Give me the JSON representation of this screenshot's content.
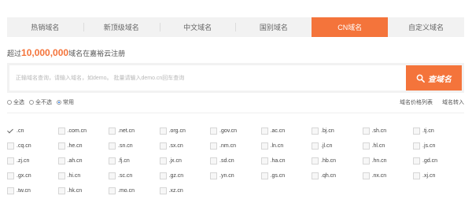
{
  "tabs": [
    {
      "label": "热销域名",
      "active": false
    },
    {
      "label": "新顶级域名",
      "active": false
    },
    {
      "label": "中文域名",
      "active": false
    },
    {
      "label": "国别域名",
      "active": false
    },
    {
      "label": "CN域名",
      "active": true
    },
    {
      "label": "自定义域名",
      "active": false
    }
  ],
  "headline": {
    "prefix": "超过",
    "count": "10,000,000",
    "suffix": "域名在嘉裕云注册"
  },
  "search": {
    "placeholder": "正输域名查询，请输入域名，如demo。 批量请输入demo.cn回车查询",
    "button_label": "查域名",
    "icon": "search-icon"
  },
  "filters": [
    {
      "label": "全选",
      "checked": false
    },
    {
      "label": "全不选",
      "checked": false
    },
    {
      "label": "常用",
      "checked": true
    }
  ],
  "links": {
    "price_list": "域名价格列表",
    "transfer": "域名转入"
  },
  "accent_color": "#f4743b",
  "domains": [
    {
      "label": ".cn",
      "checked": true
    },
    {
      "label": ".com.cn",
      "checked": false
    },
    {
      "label": ".net.cn",
      "checked": false
    },
    {
      "label": ".org.cn",
      "checked": false
    },
    {
      "label": ".gov.cn",
      "checked": false
    },
    {
      "label": ".ac.cn",
      "checked": false
    },
    {
      "label": ".bj.cn",
      "checked": false
    },
    {
      "label": ".sh.cn",
      "checked": false
    },
    {
      "label": ".tj.cn",
      "checked": false
    },
    {
      "label": ".cq.cn",
      "checked": false
    },
    {
      "label": ".he.cn",
      "checked": false
    },
    {
      "label": ".sn.cn",
      "checked": false
    },
    {
      "label": ".sx.cn",
      "checked": false
    },
    {
      "label": ".nm.cn",
      "checked": false
    },
    {
      "label": ".ln.cn",
      "checked": false
    },
    {
      "label": ".jl.cn",
      "checked": false
    },
    {
      "label": ".hl.cn",
      "checked": false
    },
    {
      "label": ".js.cn",
      "checked": false
    },
    {
      "label": ".zj.cn",
      "checked": false
    },
    {
      "label": ".ah.cn",
      "checked": false
    },
    {
      "label": ".fj.cn",
      "checked": false
    },
    {
      "label": ".jx.cn",
      "checked": false
    },
    {
      "label": ".sd.cn",
      "checked": false
    },
    {
      "label": ".ha.cn",
      "checked": false
    },
    {
      "label": ".hb.cn",
      "checked": false
    },
    {
      "label": ".hn.cn",
      "checked": false
    },
    {
      "label": ".gd.cn",
      "checked": false
    },
    {
      "label": ".gx.cn",
      "checked": false
    },
    {
      "label": ".hi.cn",
      "checked": false
    },
    {
      "label": ".sc.cn",
      "checked": false
    },
    {
      "label": ".gz.cn",
      "checked": false
    },
    {
      "label": ".yn.cn",
      "checked": false
    },
    {
      "label": ".gs.cn",
      "checked": false
    },
    {
      "label": ".qh.cn",
      "checked": false
    },
    {
      "label": ".nx.cn",
      "checked": false
    },
    {
      "label": ".xj.cn",
      "checked": false
    },
    {
      "label": ".tw.cn",
      "checked": false
    },
    {
      "label": ".hk.cn",
      "checked": false
    },
    {
      "label": ".mo.cn",
      "checked": false
    },
    {
      "label": ".xz.cn",
      "checked": false
    }
  ]
}
